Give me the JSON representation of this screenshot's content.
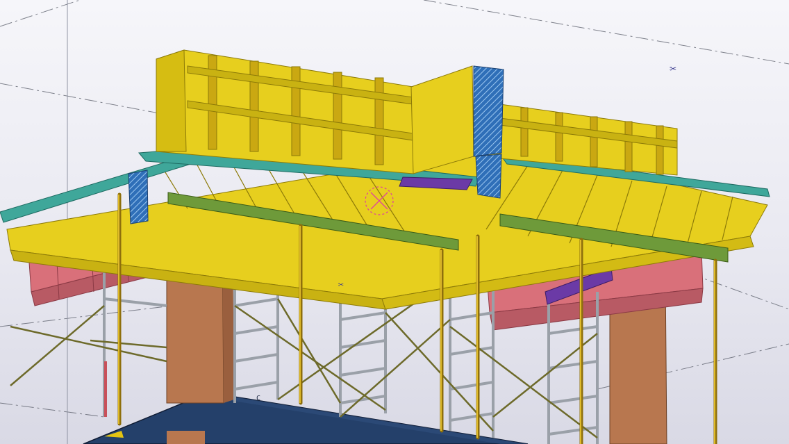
{
  "view": {
    "grid_label": "C",
    "marker_glyph": "✂"
  },
  "colors": {
    "background_top": "#f6f6fa",
    "background_bottom": "#d9d9e5",
    "formwork_yellow": "#e7cf1e",
    "formwork_dark": "#b89f0d",
    "deck_teal": "#3fa79a",
    "beam_green": "#6e9a3a",
    "support_pink": "#d9707a",
    "column_brown": "#b8774f",
    "waler_purple": "#6b3aa6",
    "slab_blue": "#24406a",
    "scaffold_grey": "#9aa0a8",
    "prop_gold": "#c8a221",
    "hatch_blue": "#4c8ad1"
  }
}
